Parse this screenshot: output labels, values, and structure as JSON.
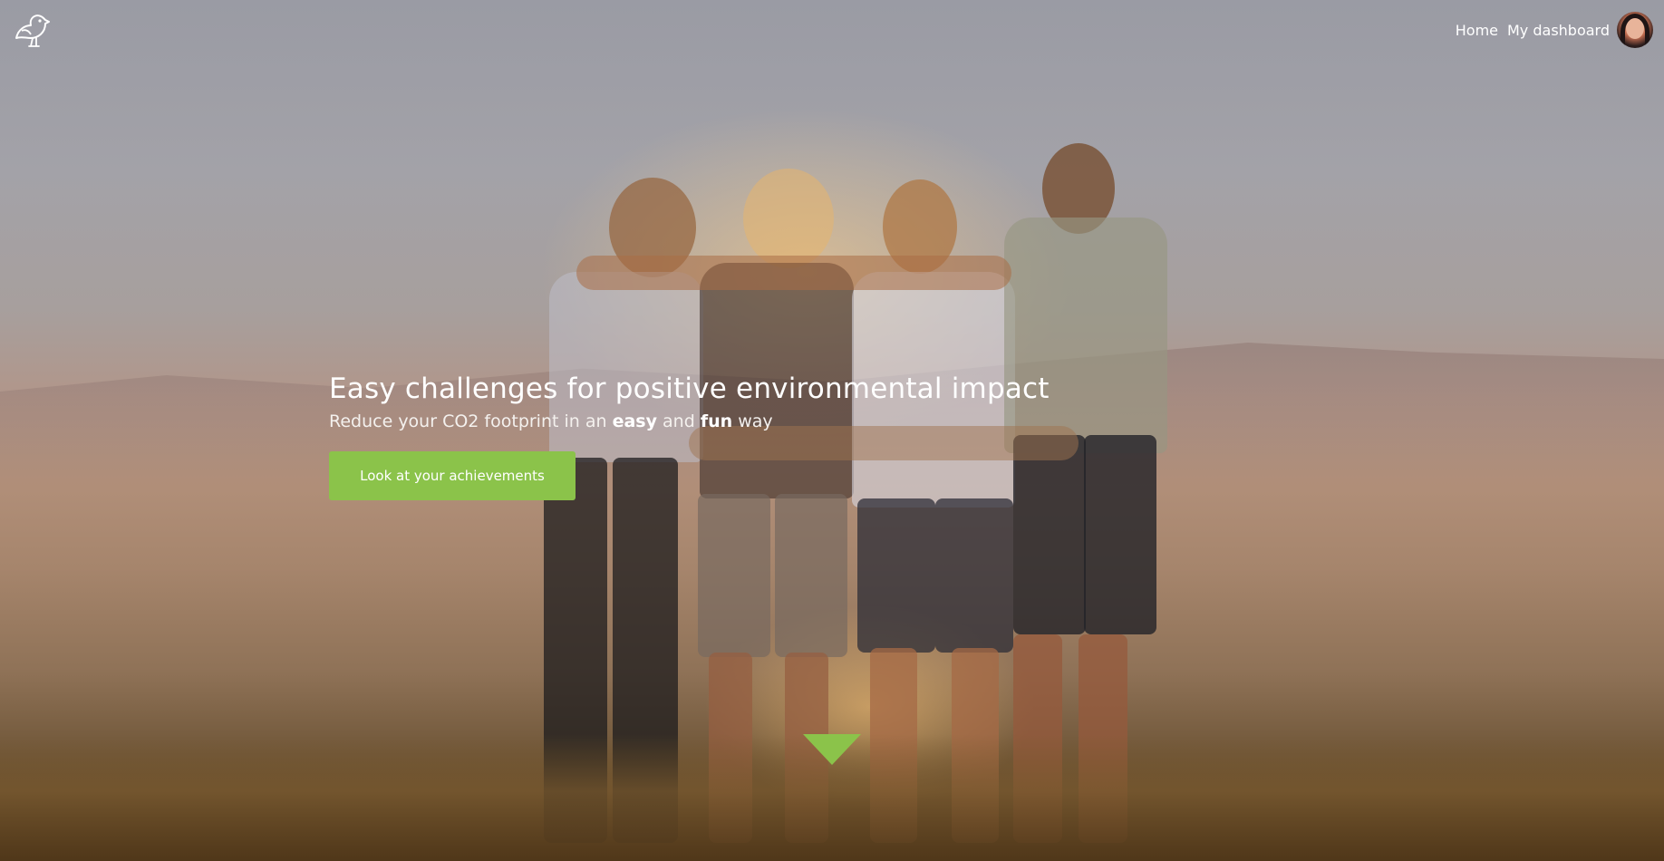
{
  "nav": {
    "logo_icon": "bird-logo-icon",
    "links": [
      {
        "label": "Home"
      },
      {
        "label": "My dashboard"
      }
    ],
    "avatar_icon": "user-avatar"
  },
  "hero": {
    "headline": "Easy challenges for positive environmental impact",
    "subheadline_parts": {
      "before": "Reduce your CO2 footprint in an ",
      "emphasis1": "easy",
      "middle": " and ",
      "emphasis2": "fun",
      "after": " way"
    },
    "cta_label": "Look at your achievements",
    "scroll_icon": "scroll-down-arrow-icon"
  },
  "colors": {
    "accent": "#8bc34a",
    "text": "#ffffff"
  }
}
